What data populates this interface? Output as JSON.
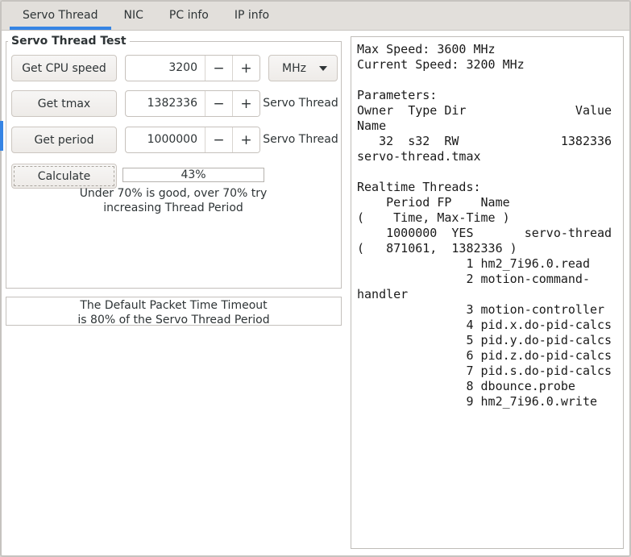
{
  "tabs": {
    "servo_thread": "Servo Thread",
    "nic": "NIC",
    "pc_info": "PC info",
    "ip_info": "IP info"
  },
  "servo_frame": {
    "title": "Servo Thread Test",
    "rows": [
      {
        "button": "Get CPU speed",
        "value": "3200",
        "unit": "MHz"
      },
      {
        "button": "Get tmax",
        "value": "1382336",
        "label": "Servo Thread"
      },
      {
        "button": "Get period",
        "value": "1000000",
        "label": "Servo Thread"
      }
    ],
    "minus": "−",
    "plus": "+",
    "calculate_label": "Calculate",
    "percent_value": "43%",
    "hint_line1": "Under 70% is good, over 70% try",
    "hint_line2": "increasing Thread Period"
  },
  "timeout_frame": {
    "line1": "The Default Packet Time Timeout",
    "line2": "is 80% of the Servo Thread Period"
  },
  "output_panel": {
    "lines": [
      "Max Speed: 3600 MHz",
      "Current Speed: 3200 MHz",
      "",
      "Parameters:",
      "Owner  Type Dir               Value",
      "Name",
      "   32  s32  RW              1382336",
      "servo-thread.tmax",
      "",
      "Realtime Threads:",
      "    Period FP    Name",
      "(    Time, Max-Time )",
      "    1000000  YES       servo-thread",
      "(   871061,  1382336 )",
      "               1 hm2_7i96.0.read",
      "               2 motion-command-",
      "handler",
      "               3 motion-controller",
      "               4 pid.x.do-pid-calcs",
      "               5 pid.y.do-pid-calcs",
      "               6 pid.z.do-pid-calcs",
      "               7 pid.s.do-pid-calcs",
      "               8 dbounce.probe",
      "               9 hm2_7i96.0.write"
    ]
  },
  "colors": {
    "accent": "#3584e4"
  }
}
